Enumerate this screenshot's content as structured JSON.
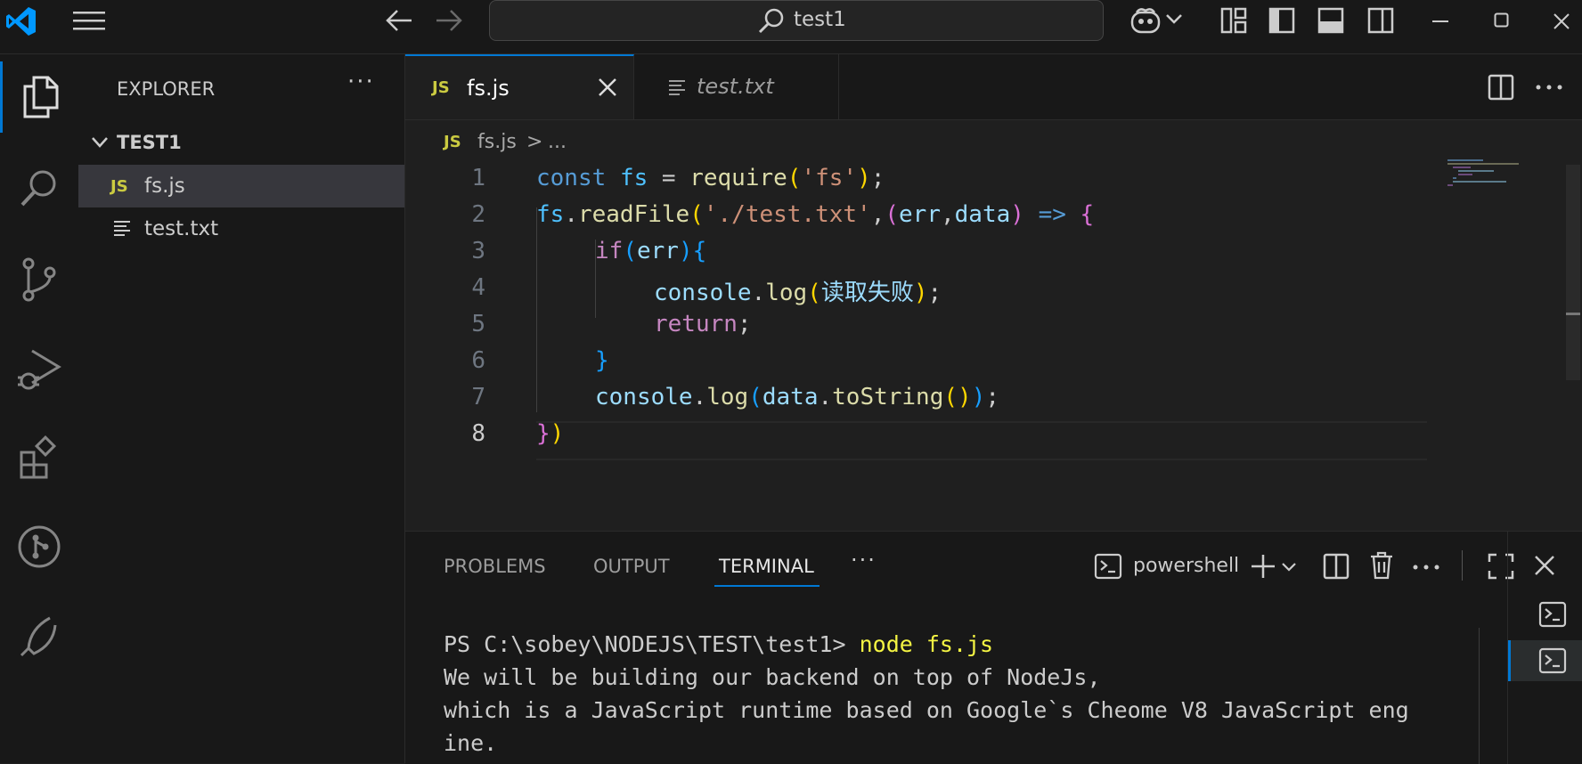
{
  "titlebar": {
    "search_text": "test1"
  },
  "sidebar": {
    "title": "EXPLORER",
    "more": "···",
    "folder": "TEST1",
    "files": [
      {
        "name": "fs.js",
        "icon": "JS"
      },
      {
        "name": "test.txt"
      }
    ]
  },
  "tabs": [
    {
      "label": "fs.js",
      "icon": "JS",
      "active": true
    },
    {
      "label": "test.txt",
      "active": false
    }
  ],
  "breadcrumb": {
    "icon": "JS",
    "file": "fs.js",
    "sep": ">",
    "rest": "..."
  },
  "editor": {
    "line_numbers": [
      "1",
      "2",
      "3",
      "4",
      "5",
      "6",
      "7",
      "8"
    ],
    "code": {
      "l1": {
        "a": "const",
        "b": " ",
        "c": "fs",
        "d": " = ",
        "e": "require",
        "f": "(",
        "g": "'fs'",
        "h": ")",
        "i": ";"
      },
      "l2": {
        "a": "fs",
        "b": ".",
        "c": "readFile",
        "d": "(",
        "e": "'./test.txt'",
        "f": ",",
        "g": "(",
        "h": "err",
        "i": ",",
        "j": "data",
        "k": ")",
        "l": " ",
        "m": "=>",
        "n": " ",
        "o": "{"
      },
      "l3": {
        "a": "if",
        "b": "(",
        "c": "err",
        "d": ")",
        "e": "{"
      },
      "l4": {
        "a": "console",
        "b": ".",
        "c": "log",
        "d": "(",
        "e": "读取失败",
        "f": ")",
        "g": ";"
      },
      "l5": {
        "a": "return",
        "b": ";"
      },
      "l6": {
        "a": "}"
      },
      "l7": {
        "a": "console",
        "b": ".",
        "c": "log",
        "d": "(",
        "e": "data",
        "f": ".",
        "g": "toString",
        "h": "()",
        "i": ")",
        "j": ";"
      },
      "l8": {
        "a": "}",
        "b": ")"
      }
    }
  },
  "panel": {
    "tabs": [
      "PROBLEMS",
      "OUTPUT",
      "TERMINAL"
    ],
    "active_tab": "TERMINAL",
    "more": "···",
    "shell": "powershell",
    "terminal": {
      "prompt": "PS C:\\sobey\\NODEJS\\TEST\\test1> ",
      "command": "node fs.js",
      "output": [
        "We will be building our backend on top of NodeJs,",
        "which is a JavaScript runtime based on Google`s Cheome V8 JavaScript eng",
        "ine."
      ]
    }
  },
  "colors": {
    "accent": "#0078d4",
    "js_badge": "#cbcb41",
    "vscode_logo": "#0098ff"
  }
}
